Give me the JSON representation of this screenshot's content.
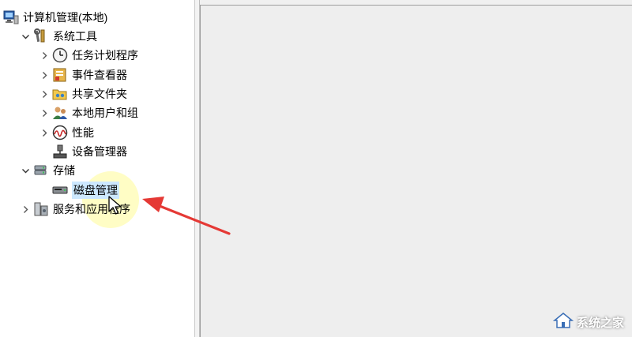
{
  "tree": {
    "root": {
      "label": "计算机管理(本地)",
      "icon": "computer-management-icon"
    },
    "system_tools": {
      "label": "系统工具",
      "icon": "tools-icon",
      "expanded": true,
      "children": [
        {
          "label": "任务计划程序",
          "icon": "clock-icon"
        },
        {
          "label": "事件查看器",
          "icon": "event-viewer-icon"
        },
        {
          "label": "共享文件夹",
          "icon": "shared-folder-icon"
        },
        {
          "label": "本地用户和组",
          "icon": "users-icon"
        },
        {
          "label": "性能",
          "icon": "performance-icon"
        },
        {
          "label": "设备管理器",
          "icon": "device-manager-icon"
        }
      ]
    },
    "storage": {
      "label": "存储",
      "icon": "storage-icon",
      "expanded": true,
      "children": [
        {
          "label": "磁盘管理",
          "icon": "disk-icon",
          "selected": true
        }
      ]
    },
    "services": {
      "label": "服务和应用程序",
      "icon": "services-icon",
      "expanded": false
    }
  },
  "annotation": {
    "arrow_color": "#e53935",
    "highlight_color": "#fff59d"
  },
  "watermark": {
    "text": "系统之家"
  }
}
